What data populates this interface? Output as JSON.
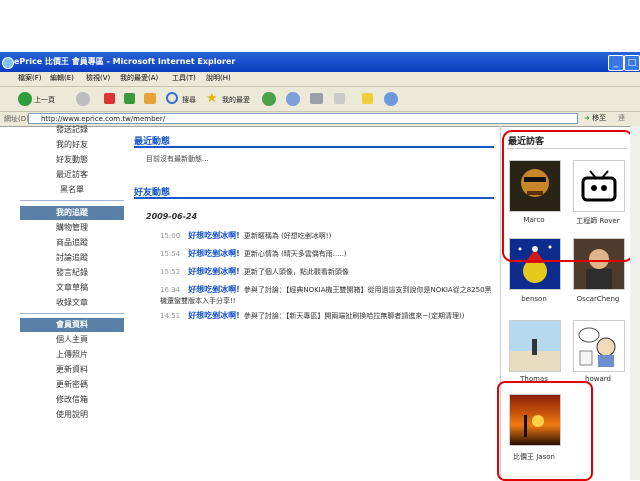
{
  "window": {
    "title": "ePrice 比價王 會員專區 - Microsoft Internet Explorer"
  },
  "menu": [
    "檔案(F)",
    "編輯(E)",
    "檢視(V)",
    "我的最愛(A)",
    "工具(T)",
    "說明(H)"
  ],
  "toolbar": {
    "back": "上一頁",
    "search": "搜尋",
    "favorites": "我的最愛"
  },
  "address": {
    "label": "網址(D)",
    "url": "http://www.eprice.com.tw/member/",
    "go": "移至",
    "links": "連"
  },
  "sidebar": {
    "top_items": [
      "發送記錄",
      "我的好友",
      "好友動態",
      "最近訪客",
      "黑名單"
    ],
    "section1_title": "我的追蹤",
    "section1_items": [
      "購物管理",
      "商品追蹤",
      "討論追蹤",
      "發言紀錄",
      "文章草稿",
      "收錄文章"
    ],
    "section2_title": "會員資料",
    "section2_items": [
      "個人主頁",
      "上傳照片",
      "更新資料",
      "更新密碼",
      "修改信箱",
      "使用說明"
    ]
  },
  "main": {
    "recent_title": "最近動態",
    "recent_empty": "目前沒有最新動態...",
    "friends_title": "好友動態",
    "date": "2009-06-24",
    "activities": [
      {
        "time": "15:00",
        "user": "好想吃剉冰啊!",
        "text": "更新暱稱為 (好想吃剉冰啊!)"
      },
      {
        "time": "15:54",
        "user": "好想吃剉冰啊!",
        "text": "更新心情為 (晴天多雲偶有雨.....)"
      },
      {
        "time": "15:52",
        "user": "好想吃剉冰啊!",
        "text": "更新了個人頭像，點此觀看新頭像"
      },
      {
        "time": "16:34",
        "user": "好想吃剉冰啊!",
        "text": "參與了討論：【經典NOKIA機王雙開箱】從用過這支到說你是NOKIA從之8250黑機還蠻雙版本入手分享!!"
      },
      {
        "time": "14:51",
        "user": "好想吃剉冰啊!",
        "text": "參與了討論：【新天專區】開兩端扯刷換哈拉無聊者請進來~(定期清理))"
      }
    ]
  },
  "visitors": {
    "title": "最近訪客",
    "people": [
      {
        "name": "Marco"
      },
      {
        "name": "工程師 Rover"
      },
      {
        "name": "benson"
      },
      {
        "name": "OscarCheng"
      },
      {
        "name": "Thomas"
      },
      {
        "name": "howard"
      },
      {
        "name": "比價王 Jason"
      }
    ]
  }
}
